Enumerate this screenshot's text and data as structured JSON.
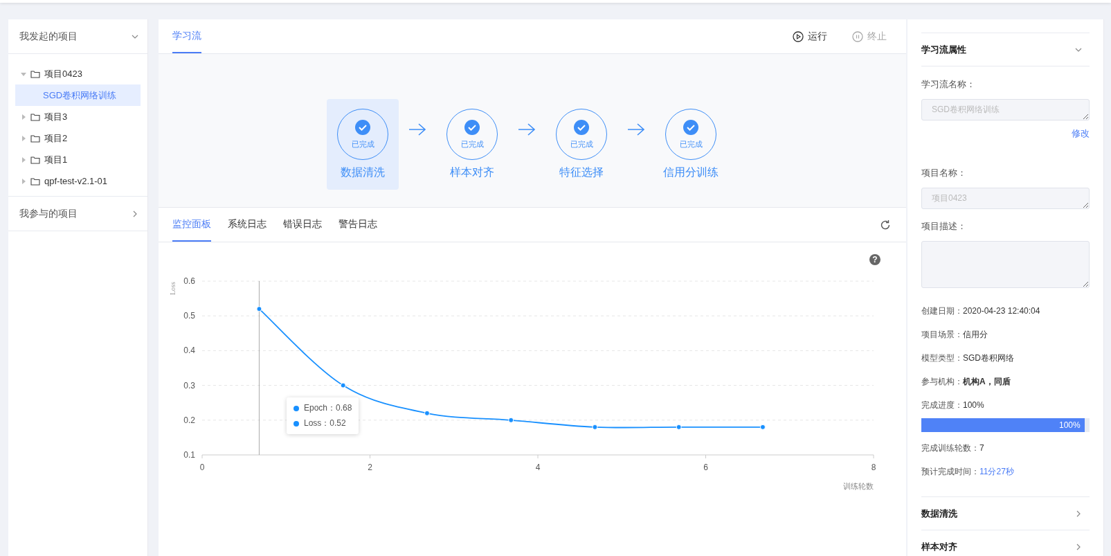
{
  "sidebar": {
    "sections": [
      {
        "title": "我发起的项目",
        "expanded": true,
        "tree": [
          {
            "label": "项目0423",
            "expanded": true,
            "selected": false,
            "children": [
              {
                "label": "SGD卷积网络训练",
                "selected": true
              }
            ]
          },
          {
            "label": "项目3",
            "expanded": false,
            "selected": false
          },
          {
            "label": "项目2",
            "expanded": false,
            "selected": false
          },
          {
            "label": "项目1",
            "expanded": false,
            "selected": false
          },
          {
            "label": "qpf-test-v2.1-01",
            "expanded": false,
            "selected": false
          }
        ]
      },
      {
        "title": "我参与的项目",
        "expanded": false
      }
    ]
  },
  "main": {
    "tabs": [
      {
        "label": "学习流",
        "selected": true
      }
    ],
    "actions": [
      {
        "label": "运行",
        "kind": "run",
        "disabled": false
      },
      {
        "label": "终止",
        "kind": "stop",
        "disabled": true
      }
    ],
    "steps": [
      {
        "status": "已完成",
        "name": "数据清洗",
        "done": true,
        "selected": true
      },
      {
        "status": "已完成",
        "name": "样本对齐",
        "done": true,
        "selected": false
      },
      {
        "status": "已完成",
        "name": "特征选择",
        "done": true,
        "selected": false
      },
      {
        "status": "已完成",
        "name": "信用分训练",
        "done": true,
        "selected": false
      }
    ],
    "log_tabs": [
      {
        "label": "监控面板",
        "selected": true
      },
      {
        "label": "系统日志",
        "selected": false
      },
      {
        "label": "错误日志",
        "selected": false
      },
      {
        "label": "警告日志",
        "selected": false
      }
    ],
    "chart": {
      "chart_data": {
        "type": "line",
        "xlabel": "训练轮数",
        "ylabel": "Loss",
        "x": [
          0.68,
          1.68,
          2.68,
          3.68,
          4.68,
          5.68,
          6.68
        ],
        "series": [
          {
            "color": "#1890ff",
            "marker": true,
            "values": [
              0.52,
              0.3,
              0.22,
              0.2,
              0.18,
              0.18,
              0.18
            ]
          }
        ],
        "grid": true,
        "ref_lines": [
          {
            "axis": "x",
            "value": 0.68
          }
        ],
        "xlim": [
          0,
          8
        ],
        "ylim": [
          0.1,
          0.6
        ],
        "xticks": [
          0,
          2,
          4,
          6,
          8
        ],
        "yticks": [
          0.1,
          0.2,
          0.3,
          0.4,
          0.5,
          0.6
        ]
      },
      "help": "?",
      "tooltip": [
        {
          "label": "Epoch：0.68",
          "color": "#1890ff"
        },
        {
          "label": "Loss：0.52",
          "color": "#1890ff"
        }
      ]
    }
  },
  "properties": {
    "sections": [
      {
        "title": "学习流属性",
        "expanded": true
      },
      {
        "title": "数据清洗",
        "expanded": false
      },
      {
        "title": "样本对齐",
        "expanded": false
      }
    ],
    "fields": [
      {
        "label": "学习流名称：",
        "value": "SGD卷积网络训练",
        "action": "修改"
      },
      {
        "label": "项目名称：",
        "value": "项目0423"
      },
      {
        "label": "项目描述："
      }
    ],
    "info": [
      {
        "label": "创建日期：",
        "value": "2020-04-23 12:40:04",
        "kind": "plain"
      },
      {
        "label": "项目场景：",
        "value": "信用分",
        "kind": "plain"
      },
      {
        "label": "模型类型：",
        "value": "SGD卷积网络",
        "kind": "plain"
      },
      {
        "label": "参与机构：",
        "value": "机构A，同盾",
        "kind": "bold"
      },
      {
        "label": "完成进度：",
        "value": "100%",
        "kind": "plain"
      }
    ],
    "progress": {
      "level": 1,
      "text": "100%"
    },
    "info2": [
      {
        "label": "完成训练轮数：",
        "value": "7",
        "kind": "plain"
      },
      {
        "label": "预计完成时间：",
        "value": "11分27秒",
        "kind": "link"
      }
    ]
  }
}
